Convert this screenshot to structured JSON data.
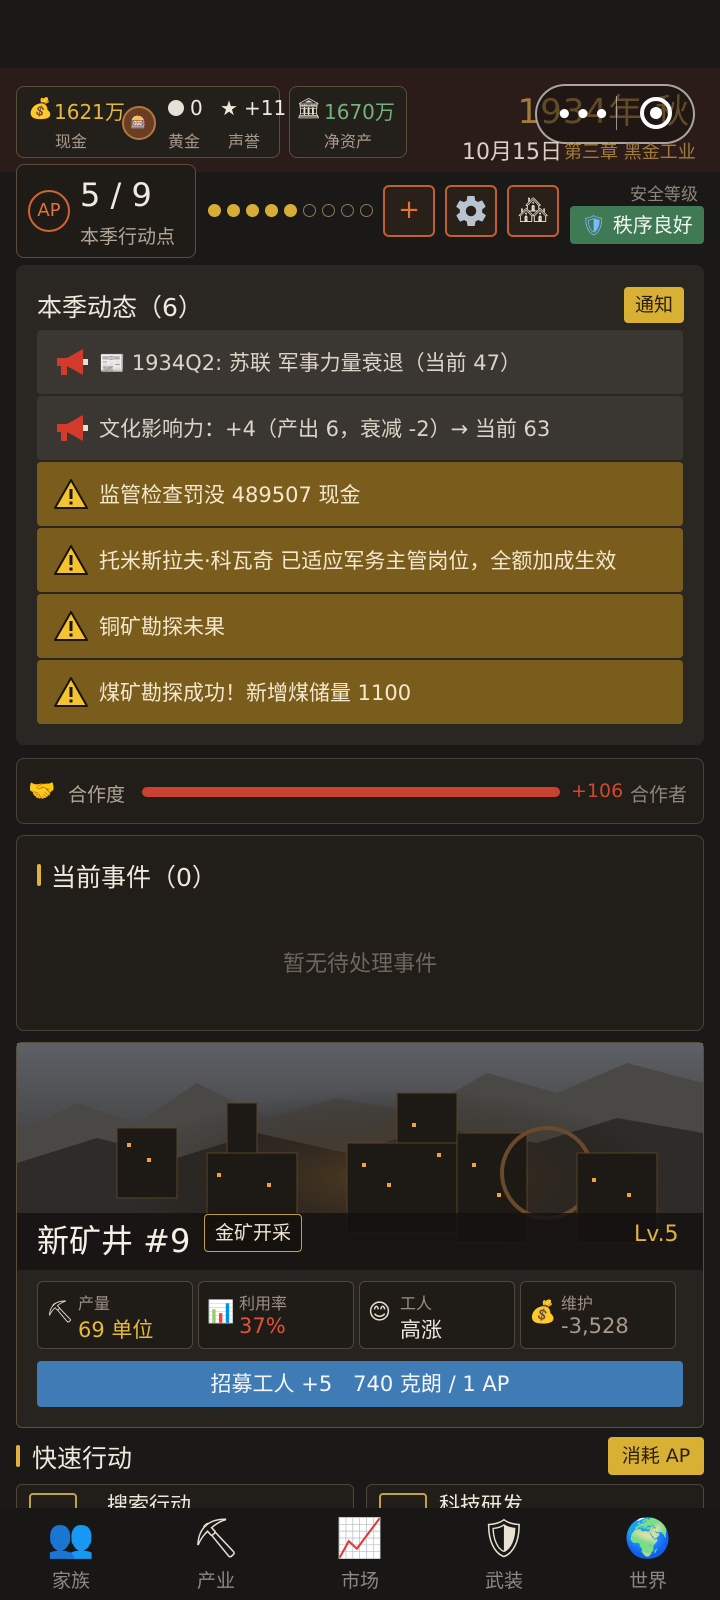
{
  "header": {
    "cash": "1621万",
    "cash_label": "现金",
    "gold": "0",
    "gold_label": "黄金",
    "reputation": "+11",
    "reputation_label": "声誉",
    "net_assets": "1670万",
    "net_assets_label": "净资产",
    "year_season": "1934年 秋",
    "date": "10月15日",
    "chapter": "第三章 黑金工业"
  },
  "action_points": {
    "badge": "AP",
    "value": "5 / 9",
    "label": "本季行动点",
    "filled": 5,
    "total": 9
  },
  "toolbar": {
    "add_label": "+",
    "settings_icon": "gear-icon",
    "home_icon": "house-icon",
    "security_title": "安全等级",
    "security_status": "秩序良好"
  },
  "feed": {
    "title": "本季动态（6）",
    "notice_label": "通知",
    "items": [
      {
        "type": "info",
        "text": "📰 1934Q2: 苏联 军事力量衰退（当前 47）"
      },
      {
        "type": "info",
        "text": "文化影响力：+4（产出 6，衰减 -2）→ 当前 63"
      },
      {
        "type": "warn",
        "text": "监管检查罚没 489507 现金"
      },
      {
        "type": "warn",
        "text": "托米斯拉夫·科瓦奇 已适应军务主管岗位，全额加成生效"
      },
      {
        "type": "warn",
        "text": "铜矿勘探未果"
      },
      {
        "type": "warn",
        "text": "煤矿勘探成功！新增煤储量 1100"
      }
    ]
  },
  "cooperation": {
    "label": "合作度",
    "value": "+106",
    "status": "合作者",
    "level": 1.0
  },
  "events": {
    "title": "当前事件（0）",
    "empty_text": "暂无待处理事件"
  },
  "mine": {
    "name": "新矿井 #9",
    "tag": "金矿开采",
    "level": "Lv.5",
    "stats": [
      {
        "label": "产量",
        "value": "69 单位",
        "icon": "pickaxe-icon"
      },
      {
        "label": "利用率",
        "value": "37%",
        "icon": "bar-chart-icon"
      },
      {
        "label": "工人",
        "value": "高涨",
        "icon": "smiley-icon"
      },
      {
        "label": "维护",
        "value": "-3,528",
        "icon": "money-bag-icon"
      }
    ],
    "recruit_label": "招募工人 +5　740 克朗 / 1 AP"
  },
  "quick_actions": {
    "title": "快速行动",
    "cost_label": "消耗 AP",
    "items": [
      "搜索行动",
      "科技研发"
    ]
  },
  "nav": [
    {
      "label": "家族",
      "icon": "family-icon"
    },
    {
      "label": "产业",
      "icon": "pickaxe-icon"
    },
    {
      "label": "市场",
      "icon": "chart-icon"
    },
    {
      "label": "武装",
      "icon": "shield-icon"
    },
    {
      "label": "世界",
      "icon": "globe-icon"
    }
  ],
  "colors": {
    "gold": "#e6b93c",
    "warn_row": "#7a5d1d",
    "accent_orange": "#d3642d",
    "safe_green": "#3f7a54",
    "recruit_blue": "#3f7cb5",
    "coop_red": "#c8422f"
  }
}
